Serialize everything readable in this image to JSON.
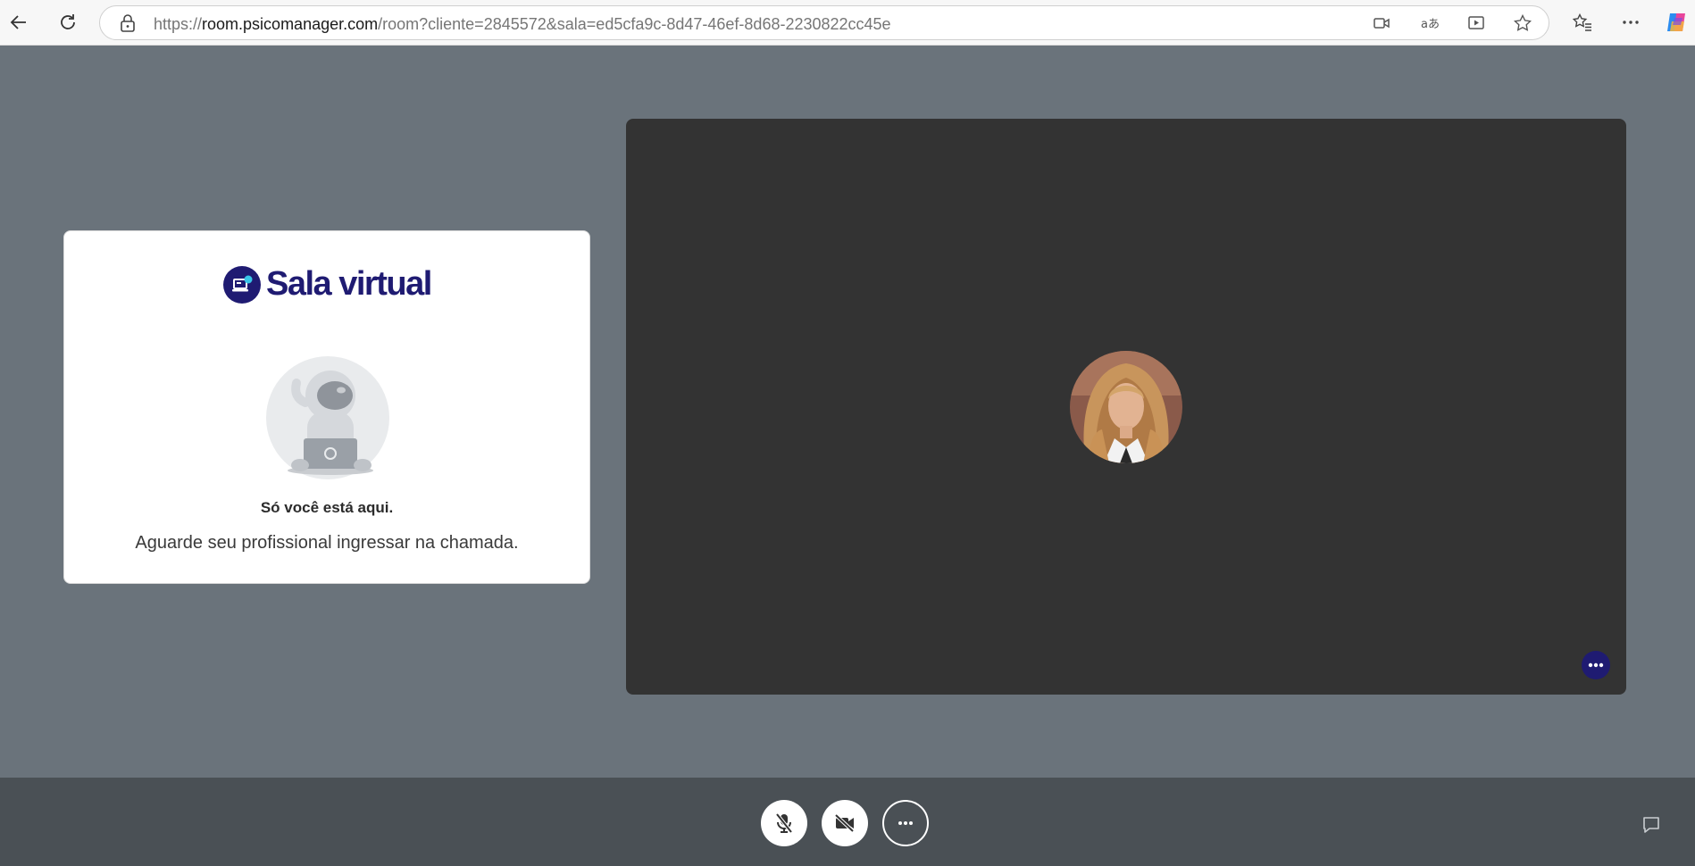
{
  "browser": {
    "url_prefix": "https://",
    "url_host": "room.psicomanager.com",
    "url_path": "/room?cliente=2845572&sala=ed5cfa9c-8d47-46ef-8d68-2230822cc45e",
    "icons": [
      "back-icon",
      "reload-icon",
      "lock-icon",
      "camera-icon",
      "read-aloud-icon",
      "immersive-reader-icon",
      "favorite-star-icon",
      "favorites-icon",
      "more-icon",
      "copilot-icon"
    ]
  },
  "card": {
    "logo_text": "Sala virtual",
    "title": "Só você está aqui.",
    "message": "Aguarde seu profissional ingressar na chamada."
  },
  "colors": {
    "page_bg": "#6a737b",
    "brand": "#1f1b72",
    "tile_bg": "#333333",
    "bar_bg": "#4a5055"
  },
  "controls": {
    "icons": [
      "mic-off-icon",
      "camera-off-icon",
      "more-options-icon",
      "chat-icon"
    ]
  }
}
